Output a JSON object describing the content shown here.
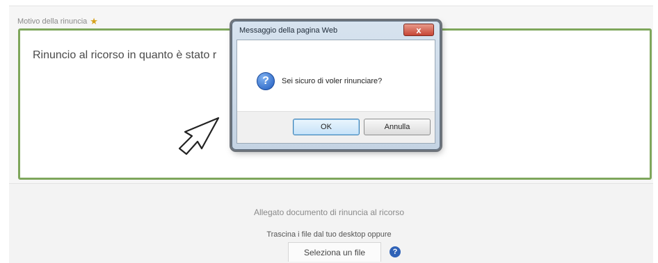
{
  "form": {
    "reason_label": "Motivo della rinuncia",
    "reason_text": "Rinuncio al ricorso in quanto è stato r"
  },
  "attachment": {
    "title": "Allegato documento di rinuncia al ricorso",
    "drag_text": "Trascina i file dal tuo desktop oppure",
    "select_button": "Seleziona un file",
    "help_icon": "?"
  },
  "dialog": {
    "title": "Messaggio della pagina Web",
    "close_glyph": "x",
    "icon_glyph": "?",
    "message": "Sei sicuro di voler rinunciare?",
    "ok_label": "OK",
    "cancel_label": "Annulla"
  },
  "icons": {
    "required": "star-icon",
    "question": "question-icon",
    "cursor": "cursor-icon",
    "help": "help-icon"
  },
  "colors": {
    "reason_border": "#7ea65b",
    "required_star": "#d6a21c",
    "help_blue": "#2f62b7",
    "close_red": "#c64535"
  }
}
